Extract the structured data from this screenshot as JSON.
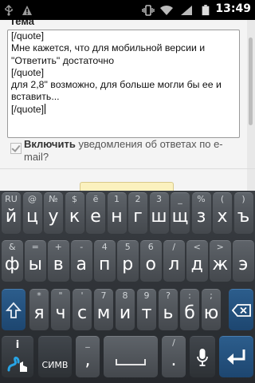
{
  "status_bar": {
    "time": "13:49"
  },
  "page": {
    "subject_label": "Тема",
    "message_lines": [
      "[/quote]",
      "Мне кажется, что для мобильной версии и",
      "\"Ответить\" достаточно",
      "[/quote]",
      "для 2,8\" возможно, для больше могли бы ее и",
      "вставить...",
      "[/quote]"
    ],
    "notify_bold": "Включить",
    "notify_rest": " уведомления об ответах по e-mail?"
  },
  "keyboard": {
    "row1": [
      {
        "sec": "RU",
        "pri": "й"
      },
      {
        "sec": "@",
        "pri": "ц"
      },
      {
        "sec": "№",
        "pri": "у"
      },
      {
        "sec": "$",
        "pri": "к"
      },
      {
        "sec": "ё",
        "pri": "е"
      },
      {
        "sec": "1",
        "pri": "н"
      },
      {
        "sec": "2",
        "pri": "г"
      },
      {
        "sec": "3",
        "pri": "ш"
      },
      {
        "sec": "_",
        "pri": "щ"
      },
      {
        "sec": "%",
        "pri": "з"
      },
      {
        "sec": "(",
        "pri": "х"
      },
      {
        "sec": ")",
        "pri": "ъ"
      }
    ],
    "row2": [
      {
        "sec": "&",
        "pri": "ф"
      },
      {
        "sec": "=",
        "pri": "ы"
      },
      {
        "sec": "+",
        "pri": "в"
      },
      {
        "sec": "-",
        "pri": "а"
      },
      {
        "sec": "4",
        "pri": "п"
      },
      {
        "sec": "5",
        "pri": "р"
      },
      {
        "sec": "6",
        "pri": "о"
      },
      {
        "sec": "/",
        "pri": "л"
      },
      {
        "sec": "<",
        "pri": "д"
      },
      {
        "sec": ">",
        "pri": "ж"
      },
      {
        "sec": "",
        "pri": "э"
      }
    ],
    "row3": [
      {
        "sec": "*",
        "pri": "я"
      },
      {
        "sec": "\"",
        "pri": "ч"
      },
      {
        "sec": "'",
        "pri": "с"
      },
      {
        "sec": "7",
        "pri": "м"
      },
      {
        "sec": "8",
        "pri": "и"
      },
      {
        "sec": "9",
        "pri": "т"
      },
      {
        "sec": "?",
        "pri": "ь"
      },
      {
        "sec": ":",
        "pri": "б"
      },
      {
        "sec": ";",
        "pri": "ю"
      }
    ],
    "row4": {
      "info_glyph": "i",
      "symbols_label": "СИМВ",
      "comma": ",",
      "comma_sec": "_",
      "period": ".",
      "period_sec": "/"
    },
    "icons": {
      "shift": "shift-arrow-icon",
      "backspace": "backspace-icon",
      "enter": "enter-arrow-icon",
      "mic": "microphone-icon",
      "swype": "swype-logo-icon"
    }
  }
}
